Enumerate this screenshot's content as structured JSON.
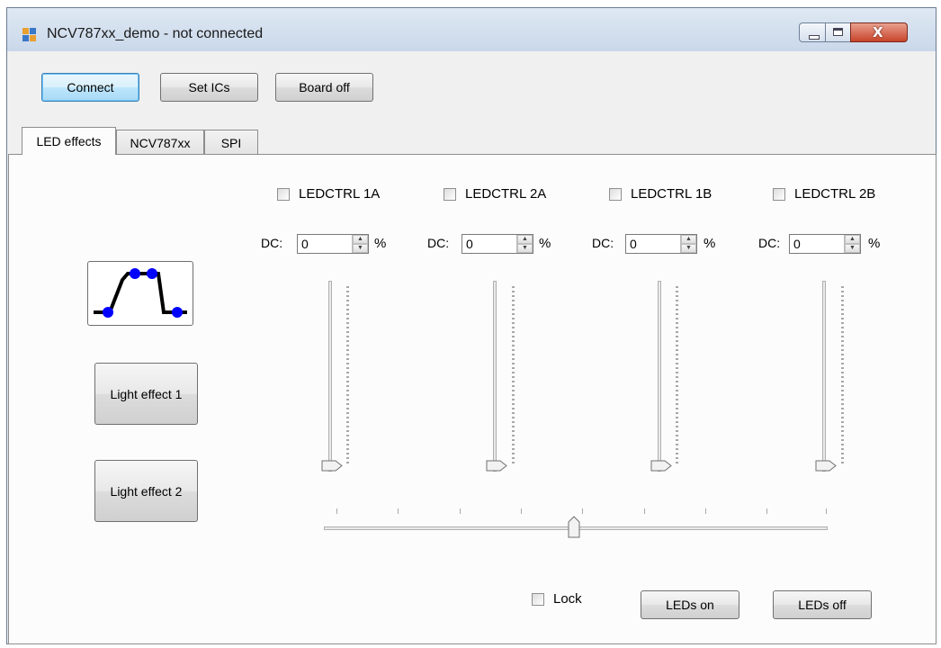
{
  "window": {
    "title": "NCV787xx_demo - not connected",
    "controls": [
      "minimize-icon",
      "maximize-icon",
      "close-icon"
    ]
  },
  "toolbar": {
    "connect_label": "Connect",
    "set_ics_label": "Set ICs",
    "board_off_label": "Board off"
  },
  "tabs": [
    {
      "label": "LED effects",
      "active": true
    },
    {
      "label": "NCV787xx",
      "active": false
    },
    {
      "label": "SPI",
      "active": false
    }
  ],
  "effects": {
    "waveform_icon": "pulse-waveform-icon",
    "light_effect_1": "Light effect 1",
    "light_effect_2": "Light effect 2"
  },
  "channels": [
    {
      "checkbox_label": "LEDCTRL 1A",
      "checked": false,
      "dc_label": "DC:",
      "dc_value": "0",
      "unit": "%",
      "slider_value": 0
    },
    {
      "checkbox_label": "LEDCTRL 2A",
      "checked": false,
      "dc_label": "DC:",
      "dc_value": "0",
      "unit": "%",
      "slider_value": 0
    },
    {
      "checkbox_label": "LEDCTRL 1B",
      "checked": false,
      "dc_label": "DC:",
      "dc_value": "0",
      "unit": "%",
      "slider_value": 0
    },
    {
      "checkbox_label": "LEDCTRL 2B",
      "checked": false,
      "dc_label": "DC:",
      "dc_value": "0",
      "unit": "%",
      "slider_value": 0
    }
  ],
  "master_slider": {
    "value_fraction": 0.5
  },
  "footer": {
    "lock_label": "Lock",
    "lock_checked": false,
    "leds_on_label": "LEDs on",
    "leds_off_label": "LEDs off"
  },
  "colors": {
    "waveform_line": "#000000",
    "waveform_points": "#0000ff",
    "window_bg": "#f0f0f0",
    "tab_page_bg": "#fcfcfc",
    "default_button_border": "#3c7fb1"
  }
}
